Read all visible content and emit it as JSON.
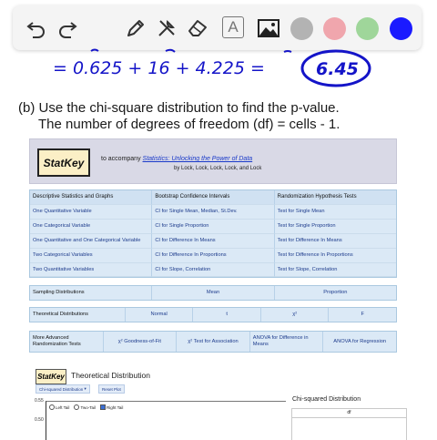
{
  "toolbar": {
    "tools": [
      "undo-icon",
      "redo-icon",
      "pen-icon",
      "tools-icon",
      "eraser-icon",
      "text-icon",
      "image-icon"
    ],
    "text_tool_label": "A",
    "colors": [
      "#b3b3b3",
      "#f0a6ad",
      "#9fd69a",
      "#1a1aff"
    ]
  },
  "handwriting": {
    "line": "= 0.625 + 16 + 4.225 =",
    "result": "6.45"
  },
  "question": {
    "part_b": "(b) Use the chi-square distribution to find the p-value.",
    "df_note": "The number of degrees of freedom (df) = cells - 1."
  },
  "statkey": {
    "logo": "StatKey",
    "accompany_prefix": "to accompany",
    "book_title": "Statistics: Unlocking the Power of Data",
    "authors": "by Lock, Lock, Lock, Lock, and Lock",
    "table": {
      "headers": [
        "Descriptive Statistics and Graphs",
        "Bootstrap Confidence Intervals",
        "Randomization Hypothesis Tests"
      ],
      "rows": [
        [
          "One Quantitative Variable",
          "CI for Single Mean, Median, St.Dev.",
          "Test for Single Mean"
        ],
        [
          "One Categorical Variable",
          "CI for Single Proportion",
          "Test for Single Proportion"
        ],
        [
          "One Quantitative and One Categorical Variable",
          "CI for Difference In Means",
          "Test for Difference In Means"
        ],
        [
          "Two Categorical Variables",
          "CI for Difference In Proportions",
          "Test for Difference In Proportions"
        ],
        [
          "Two Quantitative Variables",
          "CI for Slope, Correlation",
          "Test for Slope, Correlation"
        ]
      ]
    },
    "sampling": {
      "label": "Sampling Distributions",
      "items": [
        "Mean",
        "Proportion"
      ]
    },
    "theoretical": {
      "label": "Theoretical Distributions",
      "items": [
        "Normal",
        "t",
        "χ²",
        "F"
      ]
    },
    "advanced": {
      "label": "More Advanced Randomization Tests",
      "items": [
        "χ² Goodness-of-Fit",
        "χ² Test for Association",
        "ANOVA for Difference in Means",
        "ANOVA for Regression"
      ]
    }
  },
  "theory": {
    "logo": "StatKey",
    "title": "Theoretical Distribution",
    "dist_select": "Chi-squared Distribution",
    "reset_button": "Reset Plot",
    "y_ticks": [
      "0.55",
      "0.50"
    ],
    "tails": [
      "Left Tail",
      "Two-Tail",
      "Right Tail"
    ],
    "selected_tail": "Right Tail",
    "side_title": "Chi-squared Distribution",
    "df_label": "df"
  }
}
